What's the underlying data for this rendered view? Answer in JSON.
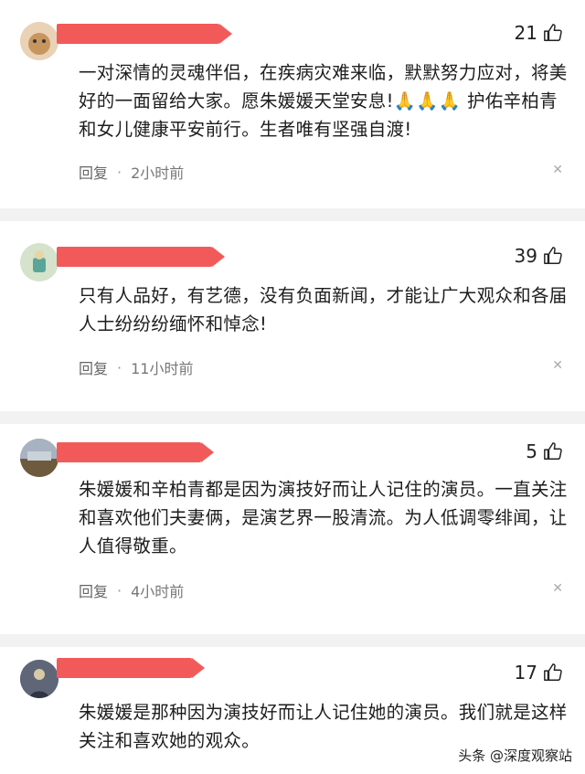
{
  "comments": [
    {
      "likes": "21",
      "text": "一对深情的灵魂伴侣，在疾病灾难来临，默默努力应对，将美好的一面留给大家。愿朱媛媛天堂安息!🙏🙏🙏 护佑辛柏青和女儿健康平安前行。生者唯有坚强自渡!",
      "reply": "回复",
      "time": "2小时前"
    },
    {
      "likes": "39",
      "text": "只有人品好，有艺德，没有负面新闻，才能让广大观众和各届人士纷纷纷缅怀和悼念!",
      "reply": "回复",
      "time": "11小时前"
    },
    {
      "likes": "5",
      "text": "朱媛媛和辛柏青都是因为演技好而让人记住的演员。一直关注和喜欢他们夫妻俩，是演艺界一股清流。为人低调零绯闻，让人值得敬重。",
      "reply": "回复",
      "time": "4小时前"
    },
    {
      "likes": "17",
      "text": "朱媛媛是那种因为演技好而让人记住她的演员。我们就是这样关注和喜欢她的观众。"
    }
  ],
  "watermark": "头条 @深度观察站",
  "icons": {
    "like": "thumbs-up-icon",
    "close": "close-icon"
  }
}
